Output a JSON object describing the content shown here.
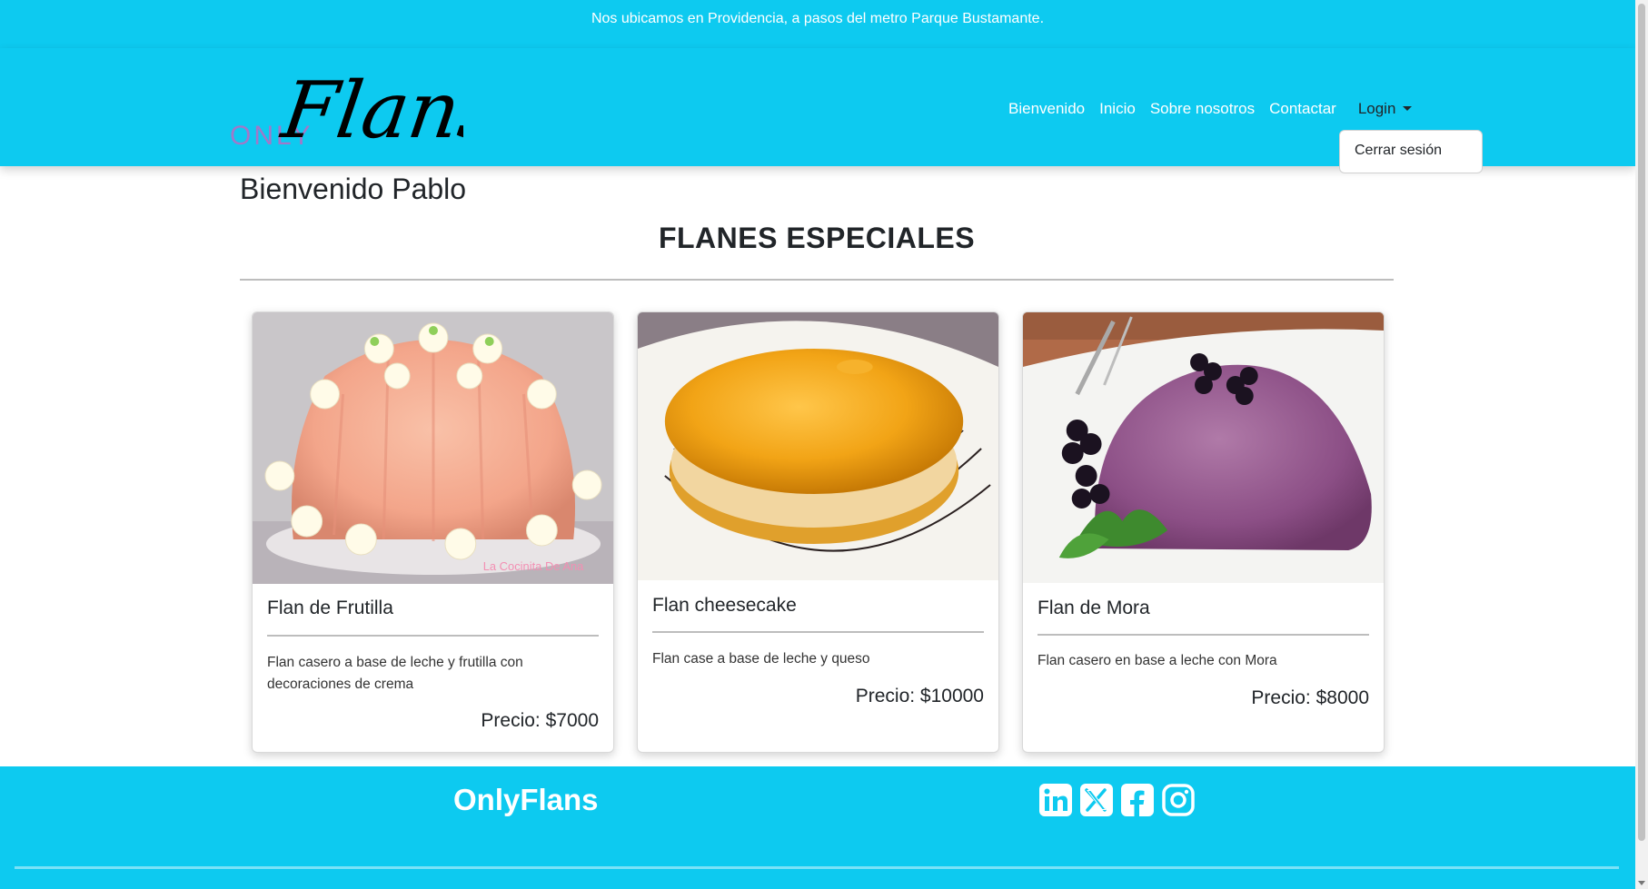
{
  "topbar": {
    "text": "Nos ubicamos en Providencia, a pasos del metro Parque Bustamante."
  },
  "brand": {
    "logo_small": "ONLY",
    "logo_script": "Flans",
    "logo_icon": "onlyflans-logo"
  },
  "nav": {
    "links": [
      "Bienvenido",
      "Inicio",
      "Sobre nosotros",
      "Contactar"
    ],
    "login_label": "Login",
    "dropdown_items": [
      "Cerrar sesión"
    ]
  },
  "main": {
    "welcome": "Bienvenido Pablo",
    "section_title": "FLANES ESPECIALES",
    "cards": [
      {
        "title": "Flan de Frutilla",
        "description": "Flan casero a base de leche y frutilla con decoraciones de crema",
        "price": "Precio: $7000",
        "image_icon": "strawberry-flan-image",
        "watermark": "La Cocinita De Ana"
      },
      {
        "title": "Flan cheesecake",
        "description": "Flan case a base de leche y queso",
        "price": "Precio: $10000",
        "image_icon": "cheesecake-flan-image"
      },
      {
        "title": "Flan de Mora",
        "description": "Flan casero en base a leche con Mora",
        "price": "Precio: $8000",
        "image_icon": "blackberry-flan-image"
      }
    ]
  },
  "footer": {
    "brand": "OnlyFlans",
    "social": [
      "linkedin-icon",
      "x-icon",
      "facebook-icon",
      "instagram-icon"
    ]
  },
  "colors": {
    "accent": "#0dcaf0",
    "text": "#212529",
    "white": "#ffffff"
  }
}
